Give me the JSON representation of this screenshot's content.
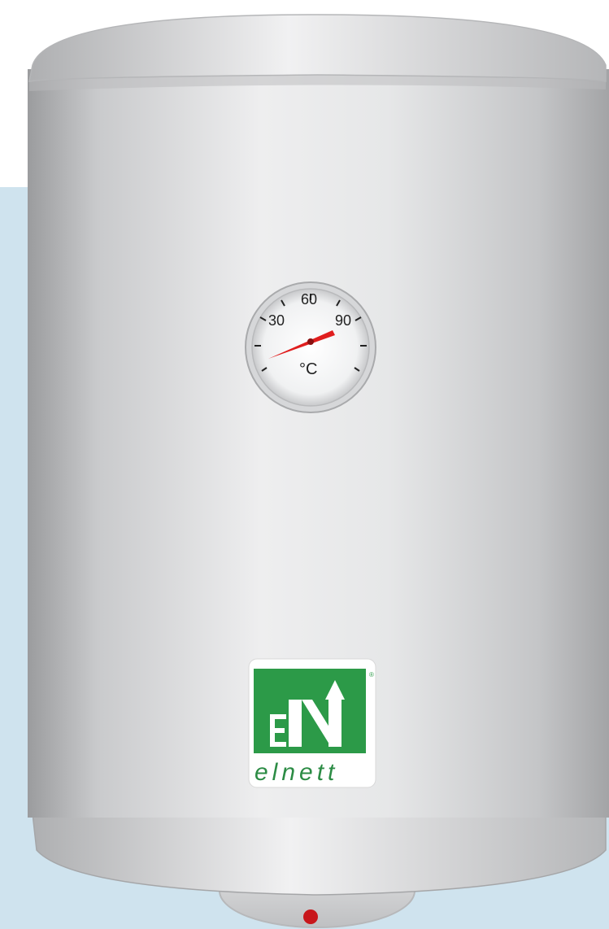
{
  "gauge": {
    "labels": [
      "30",
      "60",
      "90"
    ],
    "unit": "°C"
  },
  "logo": {
    "letters": "EN",
    "brand": "elnett",
    "registered": "®"
  },
  "colors": {
    "background_panel": "#cfe3ee",
    "body": "#e4e5e6",
    "needle": "#e01e1e",
    "logo_green": "#2c9a48",
    "indicator_light": "#c8161b"
  }
}
